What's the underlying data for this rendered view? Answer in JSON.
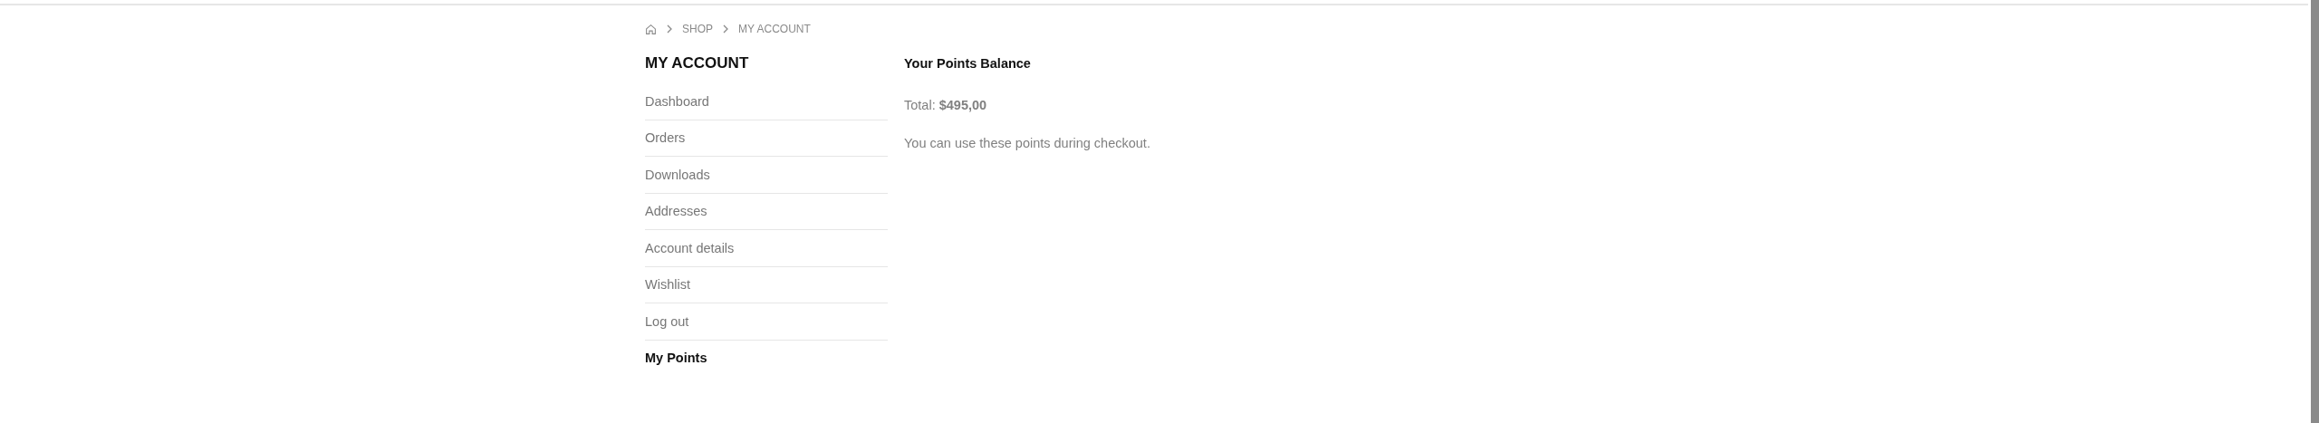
{
  "breadcrumb": [
    "SHOP",
    "MY ACCOUNT"
  ],
  "sidebar": {
    "title": "MY ACCOUNT",
    "items": [
      {
        "label": "Dashboard",
        "selected": false
      },
      {
        "label": "Orders",
        "selected": false
      },
      {
        "label": "Downloads",
        "selected": false
      },
      {
        "label": "Addresses",
        "selected": false
      },
      {
        "label": "Account details",
        "selected": false
      },
      {
        "label": "Wishlist",
        "selected": false
      },
      {
        "label": "Log out",
        "selected": false
      },
      {
        "label": "My Points",
        "selected": true
      }
    ]
  },
  "content": {
    "heading": "Your Points Balance",
    "total": "Total: **$495,00**",
    "note": "You can use these points during checkout."
  }
}
